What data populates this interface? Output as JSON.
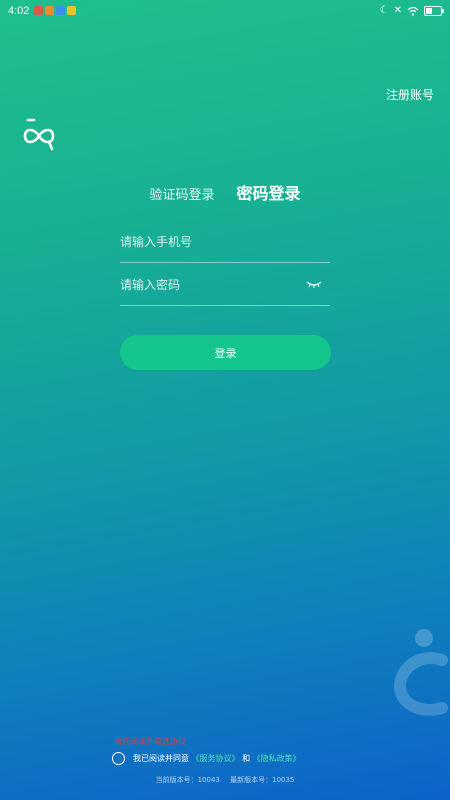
{
  "statusbar": {
    "time": "4:02",
    "app_icons": [
      {
        "name": "red-app-icon",
        "color": "#e05a4a"
      },
      {
        "name": "orange-app-icon",
        "color": "#f08a2b"
      },
      {
        "name": "blue-app-icon",
        "color": "#3d8cf0"
      },
      {
        "name": "yellow-app-icon",
        "color": "#e8c32a"
      }
    ],
    "battery_level": 0.4
  },
  "header": {
    "register_label": "注册账号"
  },
  "tabs": {
    "sms_login": "验证码登录",
    "password_login": "密码登录"
  },
  "form": {
    "phone_placeholder": "请输入手机号",
    "password_placeholder": "请输入密码",
    "login_label": "登录"
  },
  "footer": {
    "warning": "请先阅读并勾选协议",
    "agree_text": "我已阅读并同意",
    "service_link": "《服务协议》",
    "and_text": "和",
    "privacy_link": "《隐私政策》",
    "current_version": "当前版本号：10043",
    "latest_version": "最新版本号：10035"
  },
  "colors": {
    "accent": "#14c58d",
    "link": "#4ee0b4",
    "warning": "#d93d3d"
  }
}
